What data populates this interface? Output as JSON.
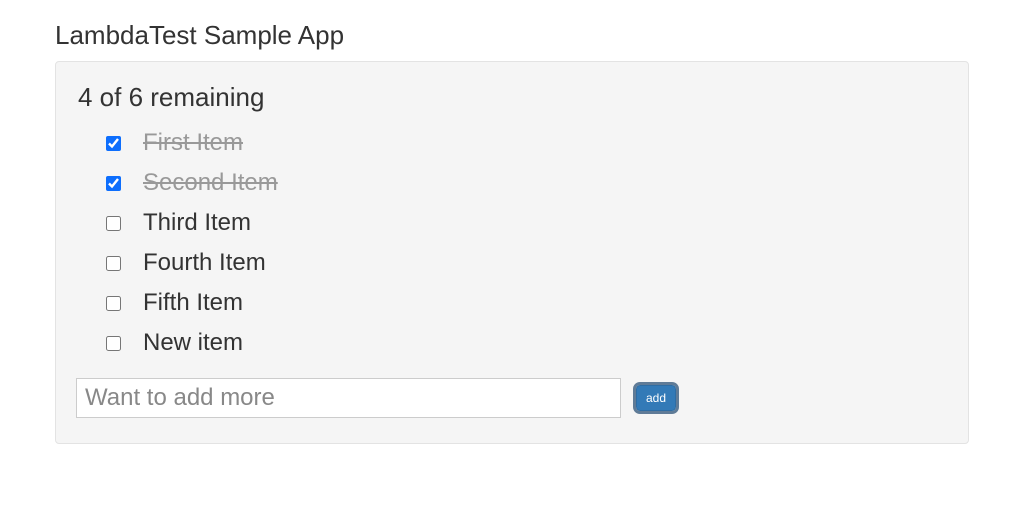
{
  "app_title": "LambdaTest Sample App",
  "remaining_text": "4 of 6 remaining",
  "items": [
    {
      "label": "First Item",
      "done": true
    },
    {
      "label": "Second Item",
      "done": true
    },
    {
      "label": "Third Item",
      "done": false
    },
    {
      "label": "Fourth Item",
      "done": false
    },
    {
      "label": "Fifth Item",
      "done": false
    },
    {
      "label": "New item",
      "done": false
    }
  ],
  "input": {
    "placeholder": "Want to add more"
  },
  "add_button_label": "add"
}
